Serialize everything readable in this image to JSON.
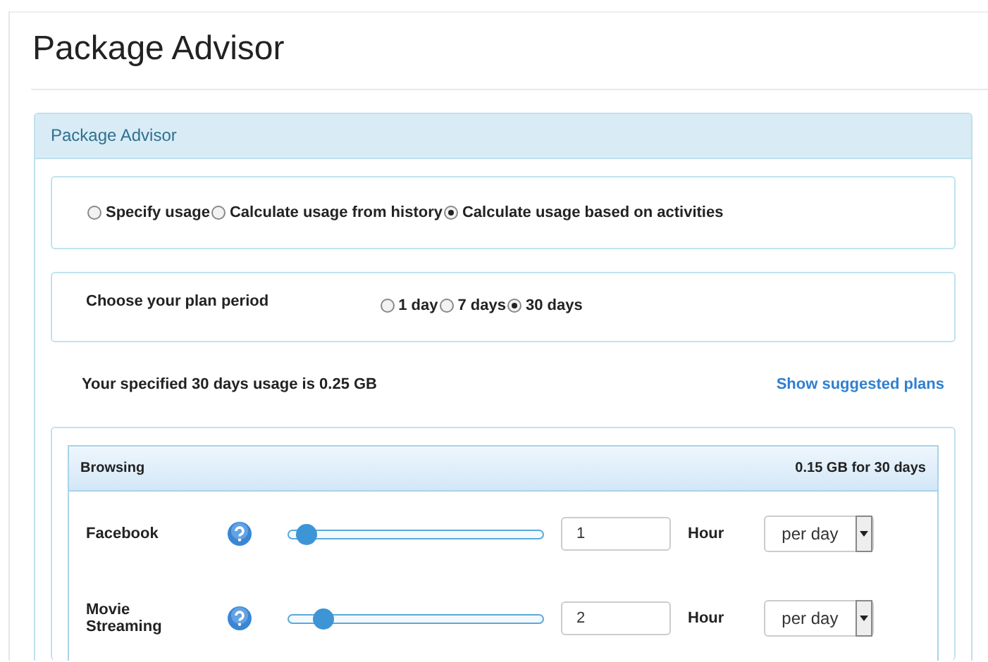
{
  "page_title": "Package Advisor",
  "panel": {
    "title": "Package Advisor",
    "modes": [
      {
        "label": "Specify usage",
        "selected": false
      },
      {
        "label": "Calculate usage from history",
        "selected": false
      },
      {
        "label": "Calculate usage based on activities",
        "selected": true
      }
    ],
    "period": {
      "label": "Choose your plan period",
      "options": [
        {
          "label": "1 day",
          "selected": false
        },
        {
          "label": "7 days",
          "selected": false
        },
        {
          "label": "30 days",
          "selected": true
        }
      ]
    },
    "usage_text": "Your specified 30 days usage is 0.25 GB",
    "suggest_link": "Show suggested plans",
    "category": {
      "title": "Browsing",
      "total": "0.15 GB for 30 days",
      "activities": [
        {
          "name": "Facebook",
          "level": 0.07,
          "value": "1",
          "unit": "Hour",
          "frequency": "per day"
        },
        {
          "name": "Movie Streaming",
          "level": 0.14,
          "value": "2",
          "unit": "Hour",
          "frequency": "per day"
        }
      ]
    }
  }
}
